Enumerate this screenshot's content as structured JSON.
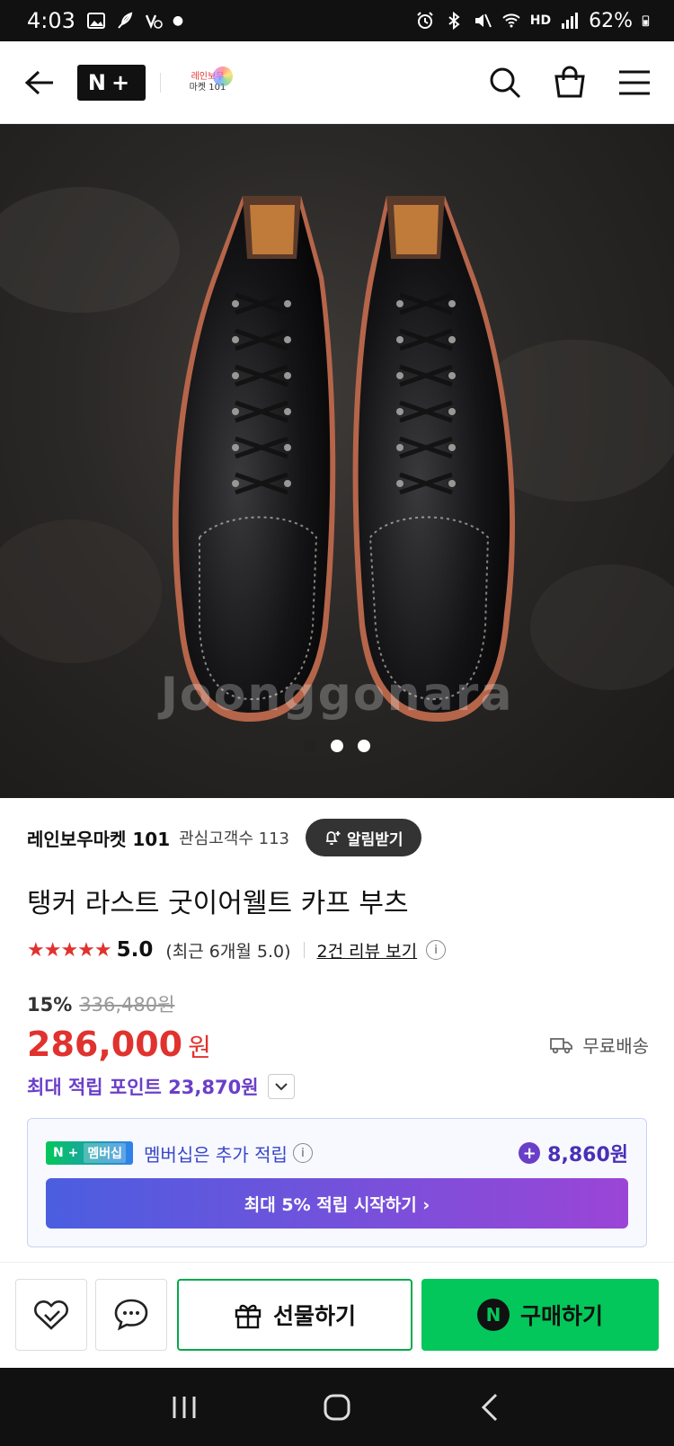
{
  "status_bar": {
    "time": "4:03",
    "battery": "62%",
    "network": "HD"
  },
  "header": {
    "brand_logo_text": "N+",
    "store_logo_line1": "레인보우",
    "store_logo_line2": "마켓 101"
  },
  "hero": {
    "watermark": "Joonggonara",
    "slide_count": 3,
    "active_slide": 1
  },
  "store": {
    "name": "레인보우마켓 101",
    "interest_count_label": "관심고객수 113",
    "alarm_button": "알림받기"
  },
  "product": {
    "title": "탱커 라스트 굿이어웰트 카프 부츠",
    "stars": "★★★★★",
    "rating": "5.0",
    "recent_rating": "(최근 6개월 5.0)",
    "review_link": "2건 리뷰 보기",
    "discount": "15%",
    "original_price": "336,480원",
    "price": "286,000",
    "currency": "원",
    "shipping": "무료배송",
    "max_points": "최대 적립 포인트 23,870원"
  },
  "membership": {
    "badge_logo": "N +",
    "badge_label": "멤버십",
    "text": "멤버십은 추가 적립",
    "points": "8,860원",
    "cta": "최대 5% 적립 시작하기 ›"
  },
  "bottom_bar": {
    "gift_label": "선물하기",
    "buy_label": "구매하기",
    "buy_logo": "N"
  },
  "colors": {
    "price_red": "#e0322e",
    "naver_green": "#03c75a",
    "points_purple": "#6a3fc8"
  }
}
